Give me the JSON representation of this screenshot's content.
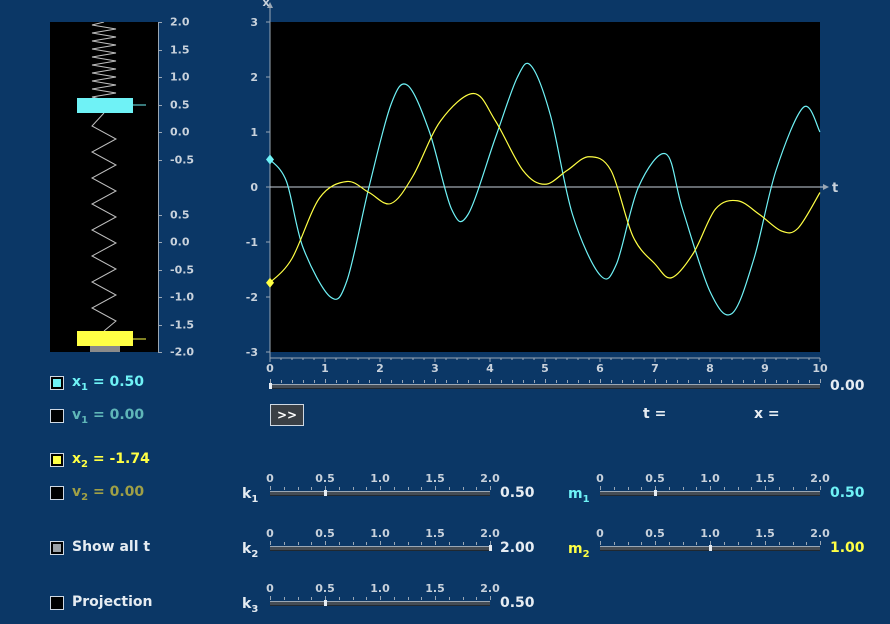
{
  "spring_scale": {
    "top_labels": [
      "2.0",
      "1.5",
      "1.0",
      "0.5",
      "0.0",
      "-0.5"
    ],
    "bottom_labels": [
      "0.5",
      "0.0",
      "-0.5",
      "-1.0",
      "-1.5",
      "-2.0"
    ],
    "mass1_color": "#6ff2f6",
    "mass2_color": "#ffff44"
  },
  "chart_data": {
    "type": "line",
    "xlabel": "t",
    "ylabel": "x",
    "xlim": [
      0,
      10
    ],
    "ylim": [
      -3,
      3
    ],
    "x_ticks": [
      "0",
      "1",
      "2",
      "3",
      "4",
      "5",
      "6",
      "7",
      "8",
      "9",
      "10"
    ],
    "y_ticks": [
      "3",
      "2",
      "1",
      "0",
      "-1",
      "-2",
      "-3"
    ],
    "grid": false,
    "series": [
      {
        "id": "x1",
        "color": "#6ff2f6",
        "points": [
          [
            0,
            0.5
          ],
          [
            0.3,
            0.1
          ],
          [
            0.6,
            -1.1
          ],
          [
            1.1,
            -2.0
          ],
          [
            1.4,
            -1.7
          ],
          [
            1.8,
            0.0
          ],
          [
            2.2,
            1.5
          ],
          [
            2.5,
            1.85
          ],
          [
            2.9,
            1.0
          ],
          [
            3.3,
            -0.4
          ],
          [
            3.6,
            -0.5
          ],
          [
            4.1,
            0.9
          ],
          [
            4.5,
            2.0
          ],
          [
            4.75,
            2.2
          ],
          [
            5.1,
            1.3
          ],
          [
            5.5,
            -0.5
          ],
          [
            6.0,
            -1.6
          ],
          [
            6.3,
            -1.4
          ],
          [
            6.7,
            0.0
          ],
          [
            7.2,
            0.6
          ],
          [
            7.5,
            -0.4
          ],
          [
            8.0,
            -1.9
          ],
          [
            8.4,
            -2.3
          ],
          [
            8.8,
            -1.3
          ],
          [
            9.2,
            0.3
          ],
          [
            9.7,
            1.45
          ],
          [
            10,
            1.0
          ]
        ]
      },
      {
        "id": "x2",
        "color": "#ffff44",
        "points": [
          [
            0,
            -1.74
          ],
          [
            0.4,
            -1.3
          ],
          [
            0.9,
            -0.2
          ],
          [
            1.4,
            0.1
          ],
          [
            1.8,
            -0.1
          ],
          [
            2.2,
            -0.3
          ],
          [
            2.6,
            0.2
          ],
          [
            3.1,
            1.2
          ],
          [
            3.7,
            1.7
          ],
          [
            4.1,
            1.2
          ],
          [
            4.6,
            0.3
          ],
          [
            5.0,
            0.05
          ],
          [
            5.4,
            0.3
          ],
          [
            5.8,
            0.55
          ],
          [
            6.2,
            0.3
          ],
          [
            6.6,
            -0.9
          ],
          [
            7.0,
            -1.4
          ],
          [
            7.3,
            -1.65
          ],
          [
            7.7,
            -1.2
          ],
          [
            8.1,
            -0.4
          ],
          [
            8.5,
            -0.25
          ],
          [
            8.9,
            -0.5
          ],
          [
            9.3,
            -0.8
          ],
          [
            9.6,
            -0.75
          ],
          [
            10,
            -0.1
          ]
        ]
      }
    ]
  },
  "time_slider": {
    "value_text": "0.00",
    "ticks": [
      "0",
      "1",
      "2",
      "3",
      "4",
      "5",
      "6",
      "7",
      "8",
      "9",
      "10"
    ],
    "fraction": 0
  },
  "play_button": {
    "label": ">>"
  },
  "readouts": {
    "t_label": "t =",
    "x_label": "x ="
  },
  "checkboxes": {
    "x1": {
      "label": "x",
      "sub": "1",
      "value": " = 0.50"
    },
    "v1": {
      "label": "v",
      "sub": "1",
      "value": " = 0.00"
    },
    "x2": {
      "label": "x",
      "sub": "2",
      "value": " = -1.74"
    },
    "v2": {
      "label": "v",
      "sub": "2",
      "value": " = 0.00"
    },
    "show_all": {
      "label": "Show all t"
    },
    "projection": {
      "label": "Projection"
    }
  },
  "sliders": {
    "tick_labels": [
      "0",
      "0.5",
      "1.0",
      "1.5",
      "2.0"
    ],
    "k1": {
      "label": "k",
      "sub": "1",
      "value": "0.50",
      "fraction": 0.25
    },
    "k2": {
      "label": "k",
      "sub": "2",
      "value": "2.00",
      "fraction": 1.0
    },
    "k3": {
      "label": "k",
      "sub": "3",
      "value": "0.50",
      "fraction": 0.25
    },
    "m1": {
      "label": "m",
      "sub": "1",
      "value": "0.50",
      "fraction": 0.25
    },
    "m2": {
      "label": "m",
      "sub": "2",
      "value": "1.00",
      "fraction": 0.5
    }
  }
}
